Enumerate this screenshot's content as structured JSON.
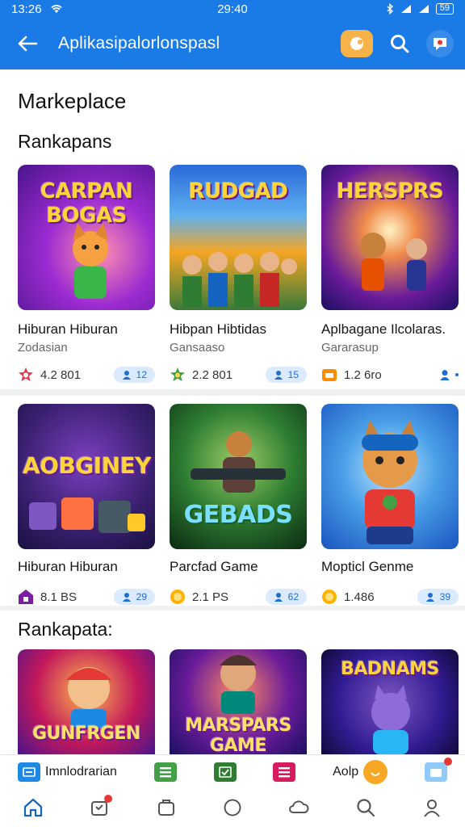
{
  "status": {
    "time": "13:26",
    "center": "29:40",
    "battery": "59"
  },
  "appbar": {
    "title": "Aplikasi­palorlonspasl",
    "back_icon": "arrow-left-icon"
  },
  "page_title": "Markeplace",
  "sections": [
    {
      "title": "Rankapans",
      "cards": [
        {
          "logo": "CARPAN BOGAS",
          "name": "Hiburan Hiburan",
          "sub": "Zodasian",
          "rating": "4.2 801",
          "pill": "12",
          "bg": [
            "#6a1bb0",
            "#f06aa8"
          ]
        },
        {
          "logo": "RUDGAD",
          "name": "Hibpan Hibtidas",
          "sub": "Gansaaso",
          "rating": "2.2 801",
          "pill": "15",
          "bg": [
            "#2a6ad8",
            "#f5a623"
          ]
        },
        {
          "logo": "HERSPRS",
          "name": "Aplbagane Ilcolaras.",
          "sub": "Gararasup",
          "rating": "1.2 6ro",
          "pill": "",
          "bg": [
            "#3a1a8a",
            "#f08a4b"
          ]
        }
      ]
    },
    {
      "title": "",
      "cards": [
        {
          "logo": "AOBGINEY",
          "name": "Hiburan Hiburan",
          "sub": "",
          "rating": "8.1 BS",
          "pill": "29",
          "bg": [
            "#3a2070",
            "#e9508a"
          ]
        },
        {
          "logo": "GEBADS",
          "name": "Parcfad Game",
          "sub": "",
          "rating": "2.1 PS",
          "pill": "62",
          "bg": [
            "#0f3a1a",
            "#4ab04a"
          ]
        },
        {
          "logo": "",
          "name": "Mopticl Genme",
          "sub": "",
          "rating": "1.486",
          "pill": "39",
          "bg": [
            "#1a55c0",
            "#7ec3ff"
          ]
        }
      ]
    },
    {
      "title": "Rankapata:",
      "cards": [
        {
          "logo": "GUNFRGEN",
          "name": "",
          "sub": "",
          "rating": "",
          "pill": "",
          "bg": [
            "#7a1a8a",
            "#f5a623"
          ]
        },
        {
          "logo": "MARSPARS GAME",
          "name": "",
          "sub": "",
          "rating": "",
          "pill": "",
          "bg": [
            "#3a1ab0",
            "#f06aa8"
          ]
        },
        {
          "logo": "BADNAMS",
          "name": "",
          "sub": "",
          "rating": "",
          "pill": "",
          "bg": [
            "#2a2a9a",
            "#e9a03a"
          ]
        }
      ]
    }
  ],
  "strip": {
    "left_label": "Imnlodrarian",
    "right_label": "Aolp"
  },
  "nav_icons": [
    "home-icon",
    "store-icon",
    "library-icon",
    "explore-icon",
    "cloud-icon",
    "search-icon",
    "profile-icon"
  ]
}
